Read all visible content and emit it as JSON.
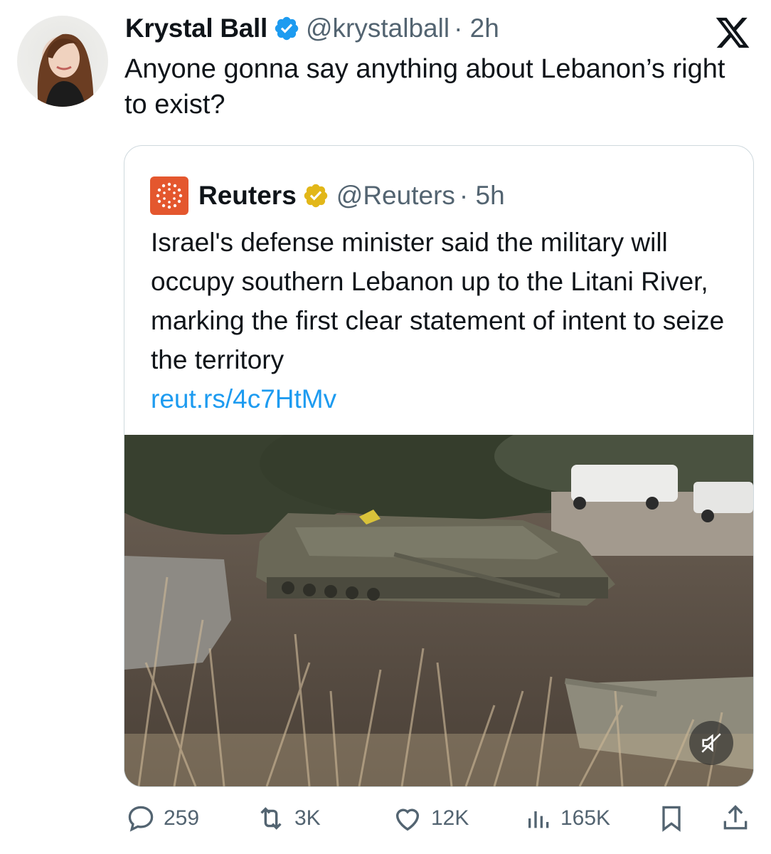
{
  "post": {
    "author_name": "Krystal Ball",
    "author_handle": "@krystalball",
    "time": "· 2h",
    "text": "Anyone gonna say anything about Lebanon’s right to exist?"
  },
  "quoted": {
    "author_name": "Reuters",
    "author_handle": "@Reuters",
    "time": "· 5h",
    "text": "Israel's defense minister said the military will occupy southern Lebanon up to the Litani River, marking the first clear statement of intent to seize the territory",
    "link": "reut.rs/4c7HtMv"
  },
  "actions": {
    "replies": "259",
    "reposts": "3K",
    "likes": "12K",
    "views": "165K"
  },
  "icons": {
    "verified": "verified-badge-icon",
    "gold_verified": "gold-verified-badge-icon",
    "x_logo": "x-logo-icon",
    "mute": "muted-speaker-icon",
    "reply": "reply-icon",
    "repost": "repost-icon",
    "like": "heart-icon",
    "views": "views-chart-icon",
    "bookmark": "bookmark-icon",
    "share": "share-icon"
  },
  "colors": {
    "text": "#0f1419",
    "secondary_text": "#536471",
    "link": "#1d9bf0",
    "verified_blue": "#1d9bf0",
    "verified_gold": "#e2b719",
    "reuters_orange": "#e4572e"
  }
}
